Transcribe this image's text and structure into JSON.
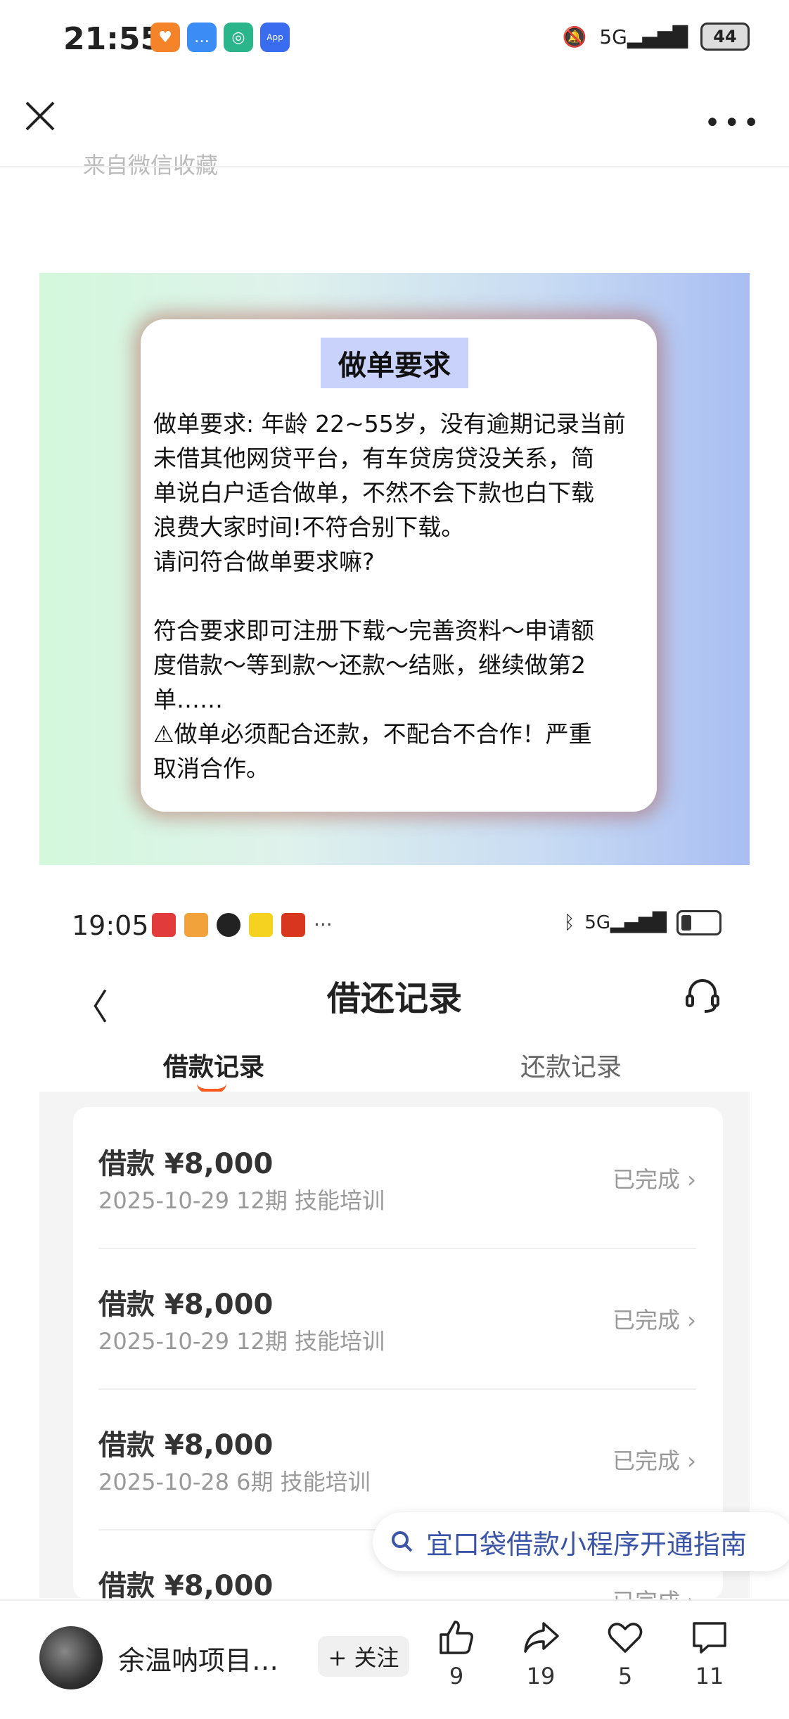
{
  "status_bar": {
    "time": "21:55",
    "signal": "5G",
    "battery": "44"
  },
  "faded_text": "来自微信收藏",
  "poster": {
    "title": "做单要求",
    "body": "做单要求: 年龄 22~55岁，没有逾期记录当前\n未借其他网贷平台，有车贷房贷没关系，简\n单说白户适合做单，不然不会下款也白下载\n浪费大家时间!不符合别下载。\n请问符合做单要求嘛?\n\n符合要求即可注册下载～完善资料～申请额\n度借款～等到款～还款～结账，继续做第2\n单……\n⚠做单必须配合还款，不配合不合作！严重\n取消合作。"
  },
  "inner_screen": {
    "time": "19:05",
    "dots": "···",
    "signal": "5G",
    "title": "借还记录",
    "tabs": [
      "借款记录",
      "还款记录"
    ],
    "records": [
      {
        "amount": "借款 ¥8,000",
        "detail": "2025-10-29 12期  技能培训",
        "status": "已完成"
      },
      {
        "amount": "借款 ¥8,000",
        "detail": "2025-10-29 12期  技能培训",
        "status": "已完成"
      },
      {
        "amount": "借款 ¥8,000",
        "detail": "2025-10-28 6期  技能培训",
        "status": "已完成"
      },
      {
        "amount": "借款 ¥8,000",
        "detail": "",
        "status": "已完成"
      }
    ]
  },
  "search_suggestion": "宜口袋借款小程序开通指南",
  "bottom_bar": {
    "author": "余温呐项目…",
    "follow": "+ 关注",
    "likes": "9",
    "shares": "19",
    "favorites": "5",
    "comments": "11"
  }
}
